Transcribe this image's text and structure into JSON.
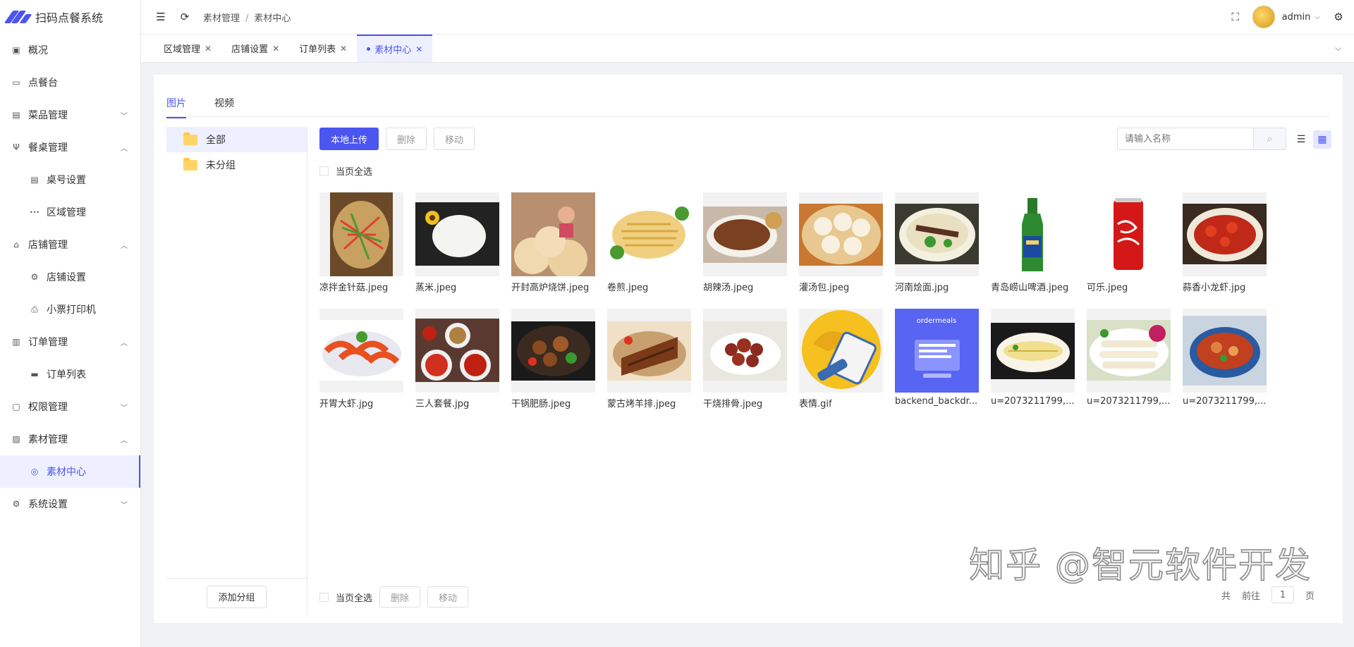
{
  "app": {
    "title": "扫码点餐系统"
  },
  "sidebar": {
    "items": [
      {
        "label": "概况",
        "icon": "dashboard-icon"
      },
      {
        "label": "点餐台",
        "icon": "monitor-icon"
      },
      {
        "label": "菜品管理",
        "icon": "message-icon",
        "arrow": "down"
      },
      {
        "label": "餐桌管理",
        "icon": "fork-knife-icon",
        "arrow": "up"
      },
      {
        "label": "桌号设置",
        "icon": "table-icon",
        "sub": true
      },
      {
        "label": "区域管理",
        "icon": "dots-icon",
        "sub": true
      },
      {
        "label": "店铺管理",
        "icon": "shop-icon",
        "arrow": "up"
      },
      {
        "label": "店铺设置",
        "icon": "gear-icon",
        "sub": true
      },
      {
        "label": "小票打印机",
        "icon": "printer-icon",
        "sub": true
      },
      {
        "label": "订单管理",
        "icon": "clipboard-icon",
        "arrow": "up"
      },
      {
        "label": "订单列表",
        "icon": "card-icon",
        "sub": true
      },
      {
        "label": "权限管理",
        "icon": "lock-icon",
        "arrow": "down"
      },
      {
        "label": "素材管理",
        "icon": "image-icon",
        "arrow": "up"
      },
      {
        "label": "素材中心",
        "icon": "palette-icon",
        "sub": true,
        "active": true
      },
      {
        "label": "系统设置",
        "icon": "settings-icon",
        "arrow": "down"
      }
    ]
  },
  "header": {
    "breadcrumb": [
      "素材管理",
      "素材中心"
    ],
    "user": "admin"
  },
  "tabs": [
    {
      "label": "区域管理"
    },
    {
      "label": "店铺设置"
    },
    {
      "label": "订单列表"
    },
    {
      "label": "素材中心",
      "active": true
    }
  ],
  "media_tabs": [
    "图片",
    "视频"
  ],
  "groups": {
    "items": [
      "全部",
      "未分组"
    ],
    "add_label": "添加分组"
  },
  "toolbar": {
    "upload": "本地上传",
    "delete": "删除",
    "move": "移动",
    "search_placeholder": "请输入名称",
    "select_all": "当页全选"
  },
  "images": [
    {
      "name": "凉拌金针菇.jpeg",
      "kind": "salad"
    },
    {
      "name": "蒸米.jpeg",
      "kind": "rice"
    },
    {
      "name": "开封高炉烧饼.jpeg",
      "kind": "bread"
    },
    {
      "name": "卷煎.jpeg",
      "kind": "roll"
    },
    {
      "name": "胡辣汤.jpeg",
      "kind": "soup"
    },
    {
      "name": "灌汤包.jpeg",
      "kind": "bun"
    },
    {
      "name": "河南烩面.jpg",
      "kind": "noodle"
    },
    {
      "name": "青岛崂山啤酒.jpeg",
      "kind": "beer"
    },
    {
      "name": "可乐.jpeg",
      "kind": "cola"
    },
    {
      "name": "蒜香小龙虾.jpg",
      "kind": "crayfish"
    },
    {
      "name": "开胃大虾.jpg",
      "kind": "shrimp"
    },
    {
      "name": "三人套餐.jpg",
      "kind": "set"
    },
    {
      "name": "干锅肥肠.jpeg",
      "kind": "pot"
    },
    {
      "name": "蒙古烤羊排.jpeg",
      "kind": "lamb"
    },
    {
      "name": "干烧排骨.jpeg",
      "kind": "ribs"
    },
    {
      "name": "表情.gif",
      "kind": "emoji"
    },
    {
      "name": "backend_backdr...",
      "kind": "backdrop",
      "caption": "ordermeals"
    },
    {
      "name": "u=2073211799,...",
      "kind": "fish"
    },
    {
      "name": "u=2073211799,...",
      "kind": "wrap"
    },
    {
      "name": "u=2073211799,...",
      "kind": "stew"
    }
  ],
  "pager": {
    "total_prefix": "共",
    "prev": "前往",
    "page": "1",
    "suffix": "页"
  },
  "watermark": "知乎 @智元软件开发",
  "colors": {
    "accent": "#4b55f0"
  }
}
